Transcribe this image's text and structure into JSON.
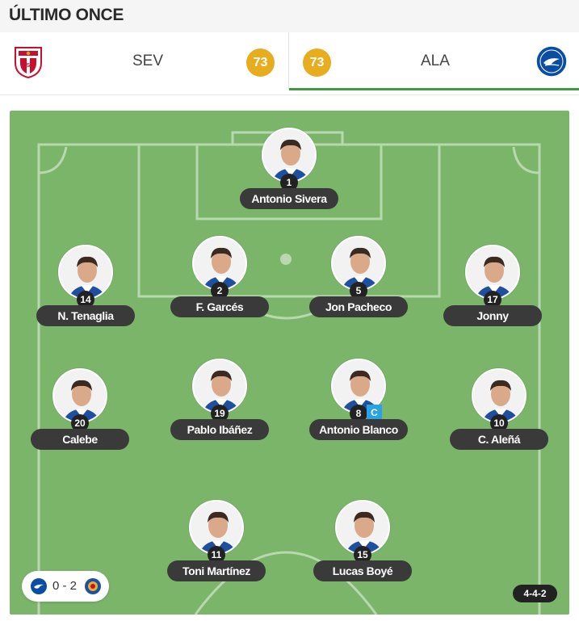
{
  "header": {
    "title": "ÚLTIMO ONCE"
  },
  "teams": {
    "home": {
      "abbr": "SEV",
      "rating": "73",
      "crest": "sevilla-crest-icon"
    },
    "away": {
      "abbr": "ALA",
      "rating": "73",
      "crest": "alaves-crest-icon",
      "selected": true
    }
  },
  "players": [
    {
      "number": "1",
      "name": "Antonio Sivera",
      "position": "GK"
    },
    {
      "number": "14",
      "name": "N. Tenaglia"
    },
    {
      "number": "2",
      "name": "F. Garcés"
    },
    {
      "number": "5",
      "name": "Jon Pacheco"
    },
    {
      "number": "17",
      "name": "Jonny"
    },
    {
      "number": "20",
      "name": "Calebe"
    },
    {
      "number": "19",
      "name": "Pablo Ibáñez"
    },
    {
      "number": "8",
      "name": "Antonio Blanco",
      "captain": "C"
    },
    {
      "number": "10",
      "name": "C. Aleñá"
    },
    {
      "number": "11",
      "name": "Toni Martínez"
    },
    {
      "number": "15",
      "name": "Lucas Boyé"
    }
  ],
  "last_result": {
    "score": "0 - 2",
    "home_badge": "alaves-crest-icon",
    "away_badge": "getafe-crest-icon"
  },
  "formation": "4-4-2",
  "colors": {
    "pitch": "#7ab56a",
    "rating": "#e7ad1f",
    "captain": "#27a3e6",
    "active_tab": "#3f9b3f",
    "label_bg": "#3a3a3a"
  }
}
